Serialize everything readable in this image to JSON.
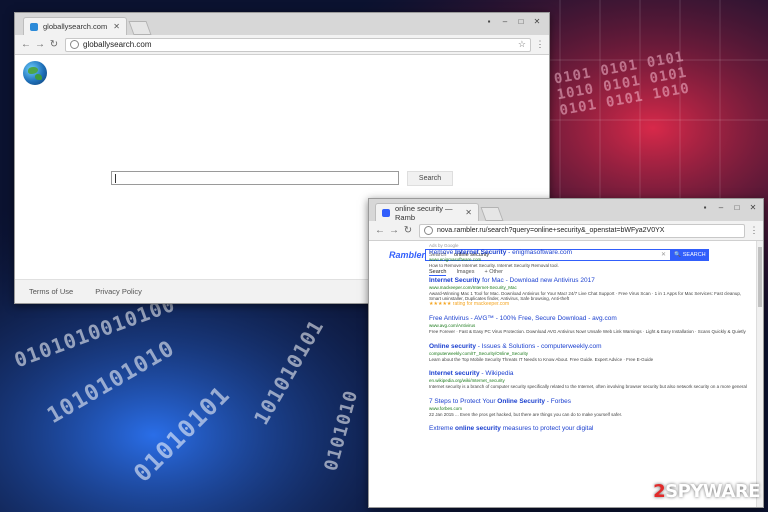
{
  "window1": {
    "tab_title": "globallysearch.com",
    "url": "globallysearch.com",
    "search_button": "Search",
    "footer": [
      "Terms of Use",
      "Privacy Policy"
    ]
  },
  "window2": {
    "tab_title": "online security — Ramb",
    "url": "nova.rambler.ru/search?query=online+security&_openstat=bWFya2V0YX",
    "logo": "Rambler/",
    "search_scope": "Search",
    "query": "online security",
    "search_button": "SEARCH",
    "tabs": [
      "Search",
      "Images",
      "Other"
    ],
    "ads_label": "Ads by Google",
    "results": [
      {
        "title_pre": "Remove ",
        "title_bold": "Internet Security",
        "title_post": " - enigmasoftware.com",
        "url": "www.enigmasoftware.com",
        "desc": "How to Remove Internet Security. Internet Security Removal tool."
      },
      {
        "title_pre": "",
        "title_bold": "Internet Security",
        "title_post": " for Mac - Download new Antivirus 2017",
        "url": "www.mackeeper.com/Internet-Security_Mac",
        "desc": "Award-Winning Mac 1 Tool for Mac. Download Antivirus for Your Mac! 24/7 Live Chat Support · Free Virus Scan · 1 in 1 Apps for Mac Services: Fast cleanup, Smart uninstaller, Duplicates finder, Antivirus, Safe browsing, Anti-theft",
        "rating": "★★★★★ rating for mackeeper.com"
      },
      {
        "title_pre": "Free Antivirus - AVG™ - 100% Free, Secure Download - avg.com",
        "title_bold": "",
        "title_post": "",
        "url": "www.avg.com/Antivirus",
        "desc": "Free Forever · Fast & Easy PC Virus Protection. Download AVG Antivirus Now! Unsafe Web Link Warnings · Light & Easy Installation · Scans Quickly & Quietly"
      },
      {
        "title_pre": "",
        "title_bold": "Online security",
        "title_post": " - Issues & Solutions - computerweekly.com",
        "url": "computerweekly.com/IT_Security/Online_Security",
        "desc": "Learn about the Top Mobile Security Threats IT Needs to Know About. Free Guide. Expert Advice · Free E-Guide"
      },
      {
        "title_pre": "",
        "title_bold": "Internet security",
        "title_post": " - Wikipedia",
        "url": "en.wikipedia.org/wiki/Internet_security",
        "desc": "Internet security is a branch of computer security specifically related to the Internet, often involving browser security but also network security on a more general"
      },
      {
        "title_pre": "7 Steps to Protect Your ",
        "title_bold": "Online Security",
        "title_post": " - Forbes",
        "url": "www.forbes.com",
        "desc": "22 Jan 2015 ... Even the pros get hacked, but there are things you can do to make yourself safer."
      },
      {
        "title_pre": "Extreme ",
        "title_bold": "online security",
        "title_post": " measures to protect your digital",
        "url": "",
        "desc": ""
      }
    ]
  },
  "watermark": {
    "two": "2",
    "rest": "SPYWARE"
  },
  "colors": {
    "rambler_blue": "#315efb",
    "link_blue": "#1a3fcf",
    "url_green": "#1b7a1b"
  }
}
